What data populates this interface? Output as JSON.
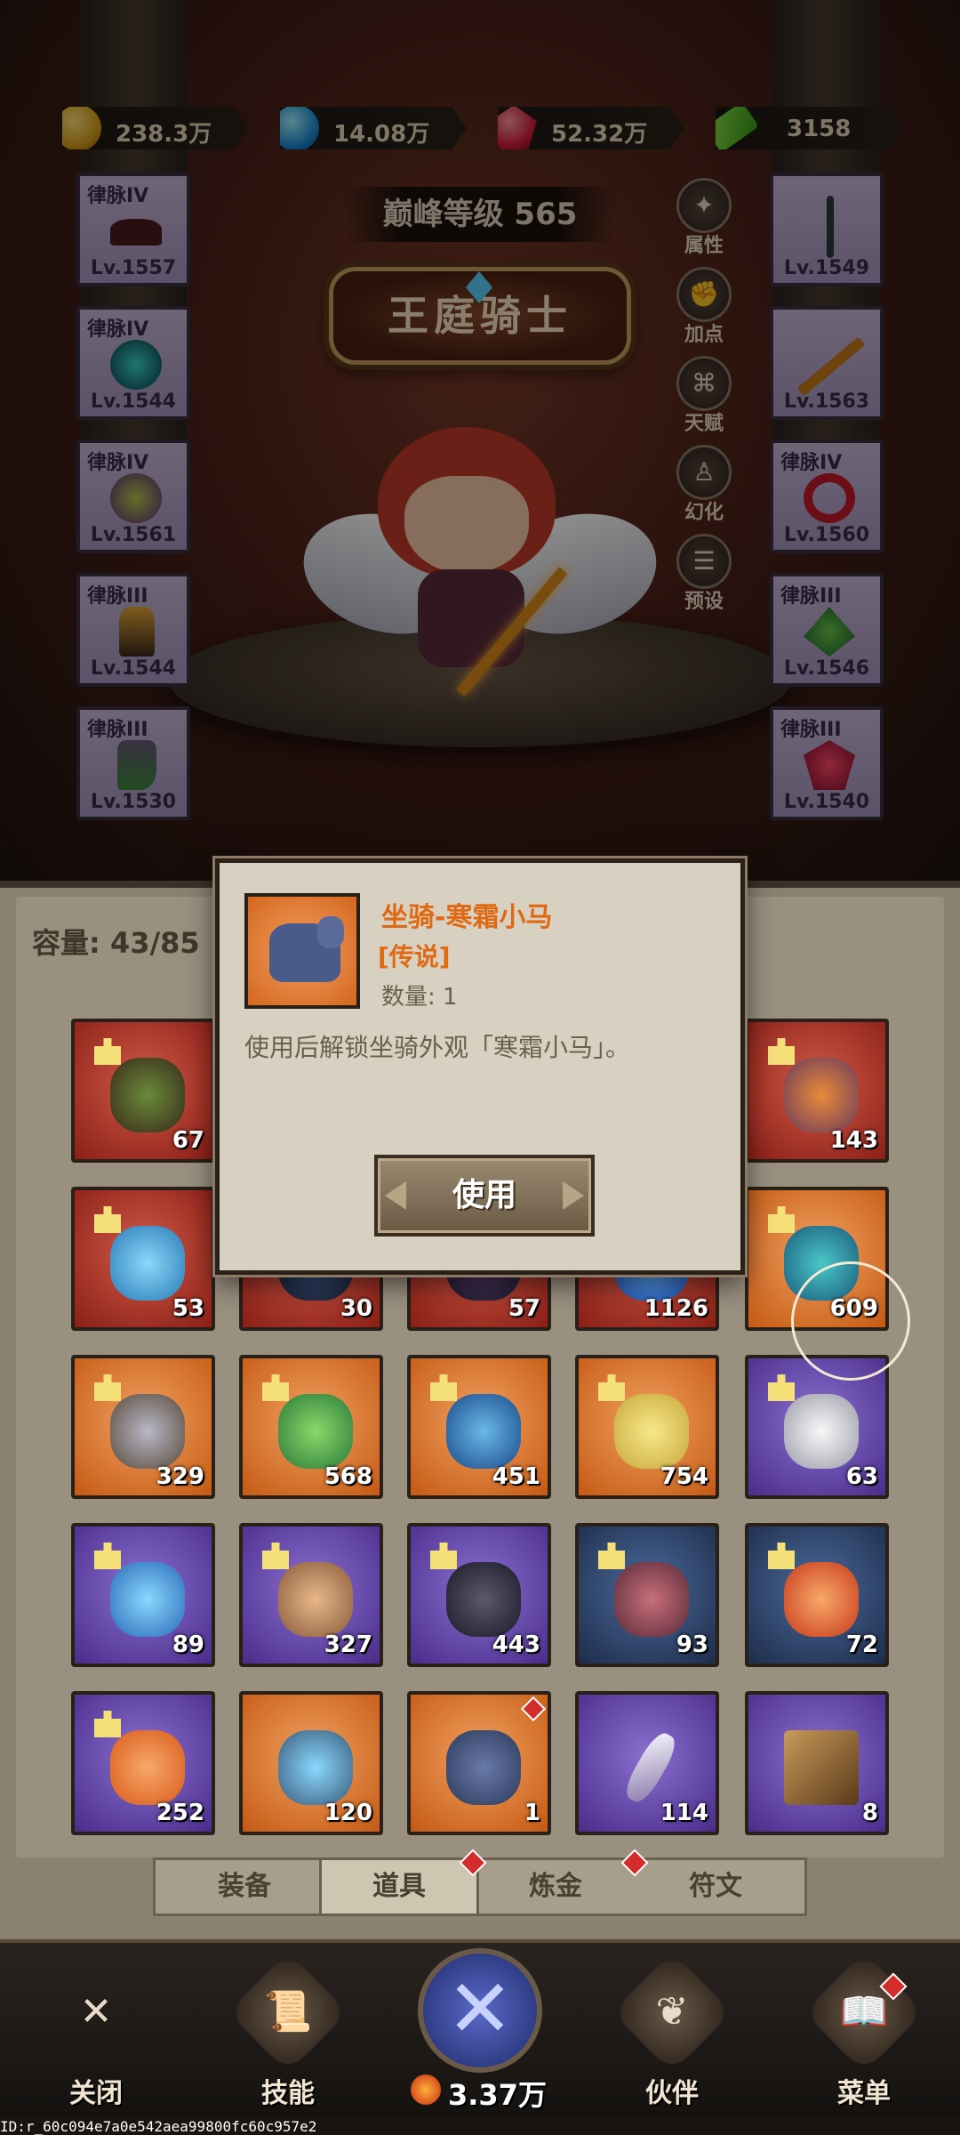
{
  "currencies": [
    {
      "icon": "gold-coin-icon",
      "value": "238.3万"
    },
    {
      "icon": "blue-gem-icon",
      "value": "14.08万"
    },
    {
      "icon": "red-ruby-icon",
      "value": "52.32万"
    },
    {
      "icon": "green-cash-icon",
      "value": "3158"
    }
  ],
  "hero": {
    "peak_level": "巅峰等级 565",
    "title": "王庭骑士"
  },
  "equipment_left": [
    {
      "name": "律脉IV",
      "level": "Lv.1557"
    },
    {
      "name": "律脉IV",
      "level": "Lv.1544"
    },
    {
      "name": "律脉IV",
      "level": "Lv.1561"
    },
    {
      "name": "律脉III",
      "level": "Lv.1544"
    },
    {
      "name": "律脉III",
      "level": "Lv.1530"
    }
  ],
  "equipment_right": [
    {
      "name": "",
      "level": "Lv.1549"
    },
    {
      "name": "",
      "level": "Lv.1563"
    },
    {
      "name": "律脉IV",
      "level": "Lv.1560"
    },
    {
      "name": "律脉III",
      "level": "Lv.1546"
    },
    {
      "name": "律脉III",
      "level": "Lv.1540"
    }
  ],
  "side_buttons": [
    {
      "label": "属性",
      "icon": "attribute-icon"
    },
    {
      "label": "加点",
      "icon": "fist-icon"
    },
    {
      "label": "天赋",
      "icon": "talent-tree-icon"
    },
    {
      "label": "幻化",
      "icon": "outfit-icon"
    },
    {
      "label": "预设",
      "icon": "preset-sliders-icon"
    }
  ],
  "inventory": {
    "capacity": "容量: 43/85",
    "items": [
      {
        "rarity": "red",
        "qty": "67"
      },
      {
        "rarity": "red",
        "qty": "143"
      },
      {
        "rarity": "red",
        "qty": "53"
      },
      {
        "rarity": "red",
        "qty": "30"
      },
      {
        "rarity": "red",
        "qty": "57"
      },
      {
        "rarity": "red",
        "qty": "1126"
      },
      {
        "rarity": "orange",
        "qty": "609"
      },
      {
        "rarity": "orange",
        "qty": "329"
      },
      {
        "rarity": "orange",
        "qty": "568"
      },
      {
        "rarity": "orange",
        "qty": "451"
      },
      {
        "rarity": "orange",
        "qty": "754"
      },
      {
        "rarity": "purple",
        "qty": "63"
      },
      {
        "rarity": "purple",
        "qty": "89"
      },
      {
        "rarity": "purple",
        "qty": "327"
      },
      {
        "rarity": "purple",
        "qty": "443"
      },
      {
        "rarity": "blue",
        "qty": "93"
      },
      {
        "rarity": "blue",
        "qty": "72"
      },
      {
        "rarity": "orange",
        "qty": "252"
      },
      {
        "rarity": "orange",
        "qty": "120"
      },
      {
        "rarity": "orange",
        "qty": "1"
      },
      {
        "rarity": "purple",
        "qty": "114"
      },
      {
        "rarity": "purple",
        "qty": "8"
      }
    ]
  },
  "tabs": [
    {
      "label": "装备"
    },
    {
      "label": "道具"
    },
    {
      "label": "炼金"
    },
    {
      "label": "符文"
    }
  ],
  "popup": {
    "item_name": "坐骑-寒霜小马",
    "rarity": "[传说]",
    "quantity": "数量: 1",
    "description": "使用后解锁坐骑外观「寒霜小马」。",
    "use_button": "使用"
  },
  "bottom_nav": {
    "close": "关闭",
    "skills": "技能",
    "power": "3.37万",
    "partner": "伙伴",
    "menu": "菜单"
  },
  "footer_id": "ID:r_60c094e7a0e542aea99800fc60c957e2",
  "colors": {
    "legend_orange": "#e06a14",
    "red_badge": "#d42c2c"
  }
}
